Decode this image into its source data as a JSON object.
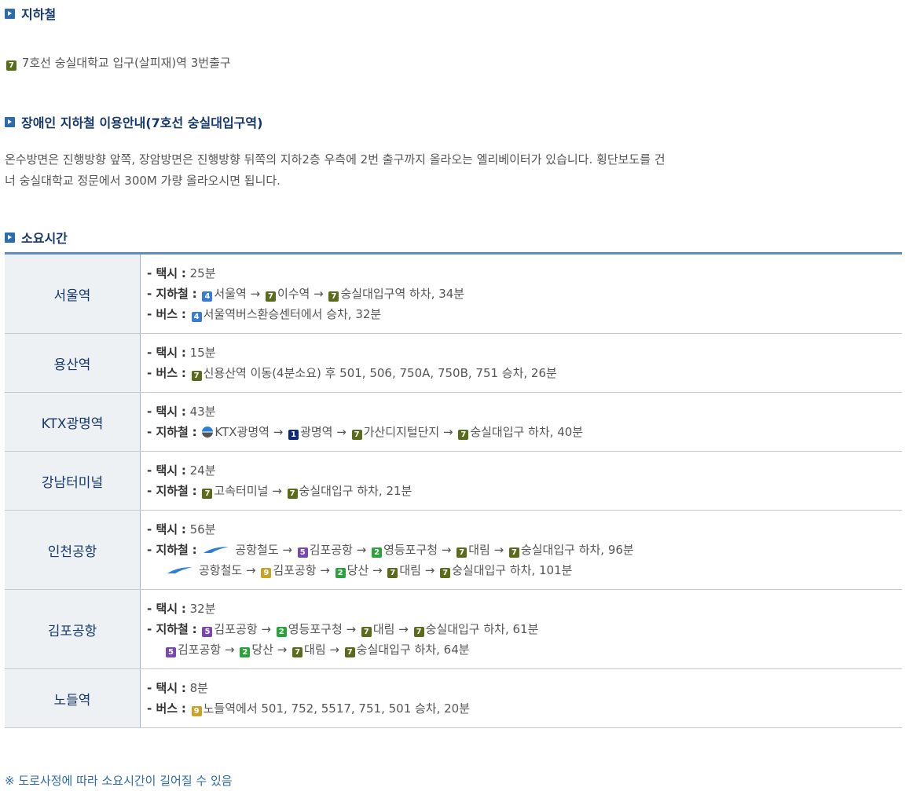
{
  "subway_section": {
    "title": "지하철",
    "line_badge": "7",
    "text": "7호선 숭실대학교 입구(살피재)역 3번출구"
  },
  "accessibility_section": {
    "title": "장애인 지하철 이용안내(7호선 숭실대입구역)",
    "text_line1": "온수방면은 진행방향 앞쪽, 장암방면은 진행방향 뒤쪽의 지하2층 우측에 2번 출구까지 올라오는 엘리베이터가 있습니다. 횡단보도를 건",
    "text_line2": "너 숭실대학교 정문에서 300M 가량 올라오시면 됩니다."
  },
  "travel_time_section": {
    "title": "소요시간",
    "rows": [
      {
        "place": "서울역",
        "taxi_label": "- 택시",
        "taxi": "25분",
        "subway_label": "- 지하철",
        "bus_label": "- 버스",
        "subway_route": [
          "서울역 →",
          "이수역 →",
          "숭실대입구역 하차, 34분"
        ],
        "bus_route": "서울역버스환승센터에서 승차, 32분"
      },
      {
        "place": "용산역",
        "taxi_label": "- 택시",
        "taxi": "15분",
        "bus_label": "- 버스",
        "bus_route": "신용산역 이동(4분소요) 후 501, 506, 750A, 750B, 751 승차, 26분"
      },
      {
        "place": "KTX광명역",
        "taxi_label": "- 택시",
        "taxi": "43분",
        "subway_label": "- 지하철",
        "subway_route": [
          "KTX광명역 →",
          "광명역 →",
          "가산디지털단지 →",
          "숭실대입구 하차, 40분"
        ]
      },
      {
        "place": "강남터미널",
        "taxi_label": "- 택시",
        "taxi": "24분",
        "subway_label": "- 지하철",
        "subway_route": [
          "고속터미널 →",
          "숭실대입구 하차, 21분"
        ]
      },
      {
        "place": "인천공항",
        "taxi_label": "- 택시",
        "taxi": "56분",
        "subway_label": "- 지하철",
        "subway_route": [
          "공항철도 →",
          "김포공항 →",
          "영등포구청 →",
          "대림 →",
          "숭실대입구 하차, 96분"
        ],
        "subway_route2": [
          "공항철도 →",
          "김포공항 →",
          "당산 →",
          "대림 →",
          "숭실대입구 하차, 101분"
        ]
      },
      {
        "place": "김포공항",
        "taxi_label": "- 택시",
        "taxi": "32분",
        "subway_label": "- 지하철",
        "subway_route": [
          "김포공항 →",
          "영등포구청 →",
          "대림 →",
          "숭실대입구 하차, 61분"
        ],
        "subway_route2": [
          "김포공항 →",
          "당산 →",
          "대림 →",
          "숭실대입구 하차, 64분"
        ]
      },
      {
        "place": "노들역",
        "taxi_label": "- 택시",
        "taxi": "8분",
        "bus_label": "- 버스",
        "bus_route": "노들역에서 501, 752, 5517, 751, 501 승차, 20분"
      }
    ]
  },
  "note": "※ 도로사정에 따라 소요시간이 길어질 수 있음",
  "badges": {
    "l1": "1",
    "l2": "2",
    "l4": "4",
    "l5": "5",
    "l7": "7",
    "l9": "9"
  },
  "colors": {
    "heading": "#14386e",
    "accent": "#2b6bb0",
    "line7": "#5a6b1b",
    "line4": "#3a7bd5",
    "line1": "#0d2a7a",
    "line5": "#7a45b5",
    "line2": "#2aa33b",
    "line9": "#c8a229"
  }
}
